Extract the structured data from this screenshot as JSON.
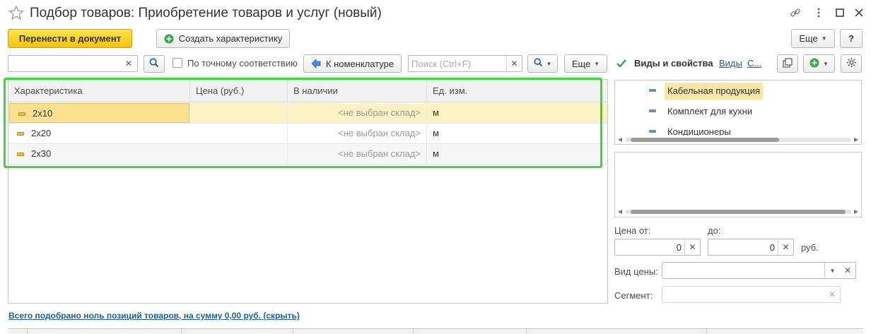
{
  "window": {
    "title": "Подбор товаров: Приобретение товаров и услуг (новый)"
  },
  "toolbar": {
    "transfer_label": "Перенести в документ",
    "create_char_label": "Создать характеристику",
    "more_label": "Еще",
    "help_label": "?"
  },
  "search_bar": {
    "search_value": "",
    "exact_match_label": "По точному соответствию",
    "exact_match_checked": false,
    "nomenclature_label": "К номенклатуре",
    "find_placeholder": "Поиск (Ctrl+F)",
    "more_label": "Еще"
  },
  "grid": {
    "columns": [
      "Характеристика",
      "Цена (руб.)",
      "В наличии",
      "Ед. изм."
    ],
    "rows": [
      {
        "characteristic": "2х10",
        "price": "",
        "stock": "<не выбран склад>",
        "unit": "м"
      },
      {
        "characteristic": "2х20",
        "price": "",
        "stock": "<не выбран склад>",
        "unit": "м"
      },
      {
        "characteristic": "2х30",
        "price": "",
        "stock": "<не выбран склад>",
        "unit": "м"
      }
    ],
    "selected_row": 0
  },
  "right_panel": {
    "kinds_checkbox_checked": true,
    "kinds_label": "Виды и свойства",
    "link_kinds": "Виды",
    "link_c": "С...",
    "tree_items": [
      "Кабельная продукция",
      "Комплект для кухни",
      "Кондиционеры"
    ],
    "tree_selected": 0,
    "price_from_label": "Цена от:",
    "price_from_value": "0",
    "price_to_label": "до:",
    "price_to_value": "0",
    "currency_label": "руб.",
    "price_type_label": "Вид цены:",
    "price_type_value": "",
    "segment_label": "Сегмент:",
    "segment_value": ""
  },
  "footer": {
    "summary_link": "Всего подобрано ноль позиций товаров, на сумму 0,00 руб. (скрыть)"
  },
  "colors": {
    "accent_yellow": "#f4c40a",
    "selection_row": "#fdf1c6",
    "highlight_frame": "#33dd33",
    "link_blue": "#1a5ea8",
    "checkbox_green": "#2e9e3a"
  }
}
